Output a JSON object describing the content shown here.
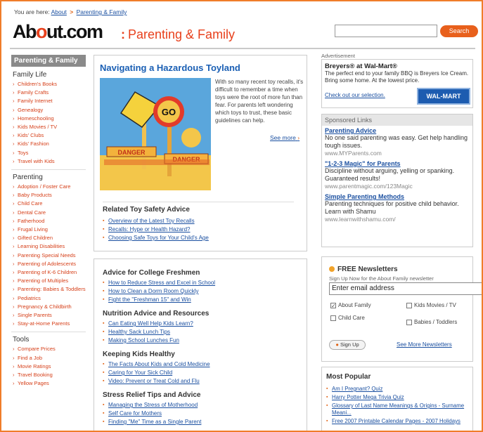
{
  "breadcrumb": {
    "prefix": "You are here:",
    "items": [
      "About",
      "Parenting & Family"
    ],
    "separator": ">"
  },
  "header": {
    "logo_pre": "Ab",
    "logo_dot": "o",
    "logo_post": "ut.com",
    "section_colon": ":",
    "section": "Parenting & Family",
    "search_label": "Search"
  },
  "leftnav": {
    "heading": "Parenting & Family",
    "groups": [
      {
        "title": "Family Life",
        "items": [
          "Children's Books",
          "Family Crafts",
          "Family Internet",
          "Genealogy",
          "Homeschooling",
          "Kids Movies / TV",
          "Kids' Clubs",
          "Kids' Fashion",
          "Toys",
          "Travel with Kids"
        ]
      },
      {
        "title": "Parenting",
        "items": [
          "Adoption / Foster Care",
          "Baby Products",
          "Child Care",
          "Dental Care",
          "Fatherhood",
          "Frugal Living",
          "Gifted Children",
          "Learning Disabilities",
          "Parenting Special Needs",
          "Parenting of Adolescents",
          "Parenting of K-6 Children",
          "Parenting of Multiples",
          "Parenting: Babies & Toddlers",
          "Pediatrics",
          "Pregnancy & Childbirth",
          "Single Parents",
          "Stay-at-Home Parents"
        ]
      },
      {
        "title": "Tools",
        "items": [
          "Compare Prices",
          "Find a Job",
          "Movie Ratings",
          "Travel Booking",
          "Yellow Pages"
        ]
      }
    ]
  },
  "feature": {
    "title": "Navigating a Hazardous Toyland",
    "text": "With so many recent toy recalls, it's difficult to remember a time when toys were the root of more fun than fear. For parents left wondering which toys to trust, these basic guidelines can help.",
    "see_more": "See more",
    "image_signs": {
      "go": "GO",
      "danger1": "DANGER",
      "danger2": "DANGER"
    },
    "related_title": "Related Toy Safety Advice",
    "related": [
      "Overview of the Latest Toy Recalls",
      "Recalls: Hype or Health Hazard?",
      "Choosing Safe Toys for Your Child's Age"
    ]
  },
  "sections": [
    {
      "title": "Advice for College Freshmen",
      "items": [
        "How to Reduce Stress and Excel in School",
        "How to Clean a Dorm Room Quickly",
        "Fight the \"Freshman 15\" and Win"
      ]
    },
    {
      "title": "Nutrition Advice and Resources",
      "items": [
        "Can Eating Well Help Kids Learn?",
        "Healthy Sack Lunch Tips",
        "Making School Lunches Fun"
      ]
    },
    {
      "title": "Keeping Kids Healthy",
      "items": [
        "The Facts About Kids and Cold Medicine",
        "Caring for Your Sick Child",
        "Video: Prevent or Treat Cold and Flu"
      ]
    },
    {
      "title": "Stress Relief Tips and Advice",
      "items": [
        "Managing the Stress of Motherhood",
        "Self Care for Mothers",
        "Finding \"Me\" Time as a Single Parent"
      ]
    }
  ],
  "ad": {
    "label": "Advertisement",
    "title": "Breyers® at Wal-Mart®",
    "text": "The perfect end to your family BBQ is Breyers Ice Cream. Bring some home. At the lowest price.",
    "link": "Check out our selection.",
    "brand": "WAL-MART"
  },
  "sponsored": {
    "heading": "Sponsored Links",
    "items": [
      {
        "title": "Parenting Advice",
        "text": "No one said parenting was easy. Get help handling tough issues.",
        "url": "www.MYParents.com"
      },
      {
        "title": "\"1-2-3 Magic\" for Parents",
        "text": "Discipline without arguing, yelling or spanking. Guaranteed results!",
        "url": "www.parentmagic.com/123Magic"
      },
      {
        "title": "Simple Parenting Methods",
        "text": "Parenting techniques for positive child behavior. Learn with Shamu",
        "url": "www.learnwithshamu.com/"
      }
    ]
  },
  "newsletter": {
    "title": "FREE Newsletters",
    "subtitle": "Sign Up Now for the About Family newsletter",
    "input_value": "Enter email address",
    "options": [
      {
        "label": "About Family",
        "checked": true
      },
      {
        "label": "Kids Movies / TV",
        "checked": false
      },
      {
        "label": "Child Care",
        "checked": false
      },
      {
        "label": "Babies / Toddlers",
        "checked": false
      }
    ],
    "signup": "Sign Up",
    "see_more": "See More Newsletters"
  },
  "popular": {
    "title": "Most Popular",
    "items": [
      "Am I Pregnant? Quiz",
      "Harry Potter Mega Trivia Quiz",
      "Glossary of Last Name Meanings & Origins - Surname Meani...",
      "Free 2007 Printable Calendar Pages - 2007 Holidays"
    ]
  },
  "colors": {
    "accent": "#e8401c",
    "link": "#1a4fa0",
    "border": "#f07d2a"
  }
}
